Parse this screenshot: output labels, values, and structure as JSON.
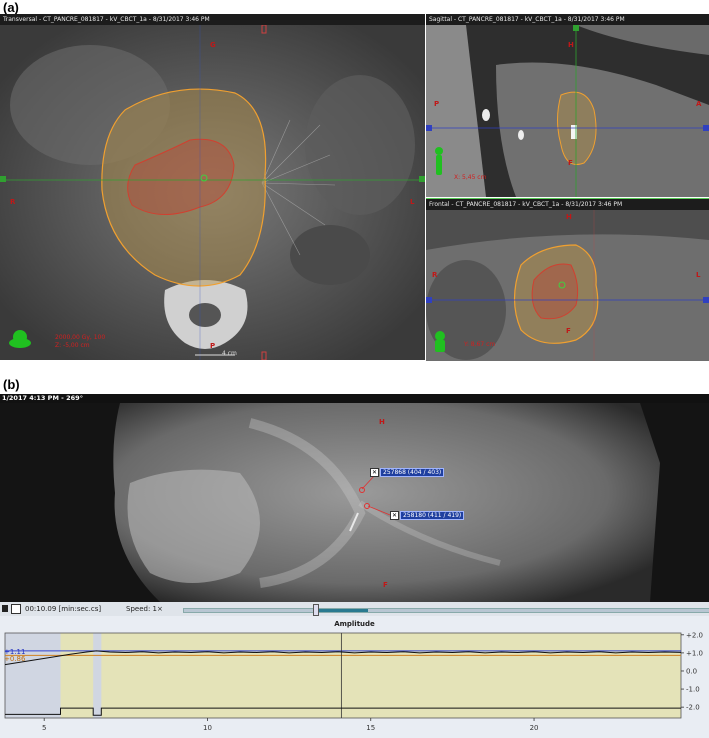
{
  "panel_labels": {
    "a": "(a)",
    "b": "(b)"
  },
  "transversal": {
    "title": "Transversal - CT_PANCRE_081817 - kV_CBCT_1a - 8/31/2017 3:46 PM",
    "orient_top": "G",
    "orient_left": "R",
    "orient_right": "L",
    "orient_bottom": "P",
    "info_line1": "2000,00 Gy, 100",
    "info_line2": "Z: -5,00 cm",
    "scale_text": "4 cm"
  },
  "sagittal": {
    "title": "Sagittal - CT_PANCRE_081817 - kV_CBCT_1a - 8/31/2017 3:46 PM",
    "orient_top": "H",
    "orient_left": "P",
    "orient_right": "A",
    "orient_bottom": "F",
    "info_line1": "X: 5,45 cm"
  },
  "frontal": {
    "title": "Frontal - CT_PANCRE_081817 - kV_CBCT_1a - 8/31/2017 3:46 PM",
    "orient_top": "H",
    "orient_left": "R",
    "orient_right": "L",
    "orient_bottom": "F",
    "info_line1": "Y: 8,67 cm"
  },
  "fluoro": {
    "header": "1/2017 4:13 PM - 269°",
    "orient_top": "H",
    "orient_bottom": "F",
    "marker1": "257868 (404 / 403)",
    "marker2": "258180 (411 / 419)"
  },
  "playback": {
    "time": "00:10.09 [min:sec.cs]",
    "speed_label": "Speed: 1×",
    "slider_position_fraction": 0.25,
    "slider_highlight_fraction": [
      0.25,
      0.35
    ]
  },
  "chart_data": {
    "type": "line",
    "title": "Amplitude",
    "xlabel": "",
    "ylabel": "",
    "x_ticks": [
      "5",
      "10",
      "15",
      "20"
    ],
    "y_ticks": [
      "+2.0",
      "+1.0",
      "0.0",
      "-1.0",
      "-2.0"
    ],
    "xlim": [
      3.8,
      24.5
    ],
    "ylim": [
      -2.6,
      2.1
    ],
    "left_values": [
      "+1.11",
      "+0.86"
    ],
    "cursor_x": 14.1,
    "series": [
      {
        "values": [
          [
            3.8,
            0.35
          ],
          [
            4.5,
            0.55
          ],
          [
            5.2,
            0.75
          ],
          [
            5.8,
            0.92
          ],
          [
            6.3,
            1.05
          ],
          [
            6.6,
            1.11
          ],
          [
            7.0,
            1.05
          ],
          [
            7.5,
            1.02
          ],
          [
            8,
            1.06
          ],
          [
            8.5,
            1.0
          ],
          [
            9,
            1.05
          ],
          [
            9.5,
            1.02
          ],
          [
            10,
            1.06
          ],
          [
            10.5,
            1.0
          ],
          [
            11,
            1.05
          ],
          [
            11.5,
            1.02
          ],
          [
            12,
            1.06
          ],
          [
            12.5,
            1.0
          ],
          [
            13,
            1.05
          ],
          [
            13.5,
            1.02
          ],
          [
            14,
            1.06
          ],
          [
            14.5,
            1.0
          ],
          [
            15,
            1.05
          ],
          [
            15.5,
            1.02
          ],
          [
            16,
            1.06
          ],
          [
            16.5,
            1.0
          ],
          [
            17,
            1.05
          ],
          [
            17.5,
            1.02
          ],
          [
            18,
            1.06
          ],
          [
            18.5,
            1.0
          ],
          [
            19,
            1.05
          ],
          [
            19.5,
            1.02
          ],
          [
            20,
            1.06
          ],
          [
            20.5,
            1.0
          ],
          [
            21,
            1.05
          ],
          [
            21.5,
            1.02
          ],
          [
            22,
            1.06
          ],
          [
            22.5,
            1.0
          ],
          [
            23,
            1.05
          ],
          [
            23.5,
            1.02
          ],
          [
            24,
            1.05
          ],
          [
            24.5,
            1.03
          ]
        ]
      },
      {
        "values": [
          [
            3.8,
            -2.4
          ],
          [
            5.5,
            -2.4
          ],
          [
            5.5,
            -2.05
          ],
          [
            6.5,
            -2.05
          ],
          [
            6.5,
            -2.45
          ],
          [
            6.75,
            -2.45
          ],
          [
            6.75,
            -2.05
          ],
          [
            24.5,
            -2.05
          ]
        ]
      }
    ],
    "reference_lines": [
      1.11,
      0.86
    ],
    "colors": {
      "plot_bg": "#e4e3b8",
      "excluded_bg": "#d0d6e2",
      "line": "#111111",
      "ref_blue": "#3040d0",
      "ref_orange": "#d08020"
    }
  }
}
